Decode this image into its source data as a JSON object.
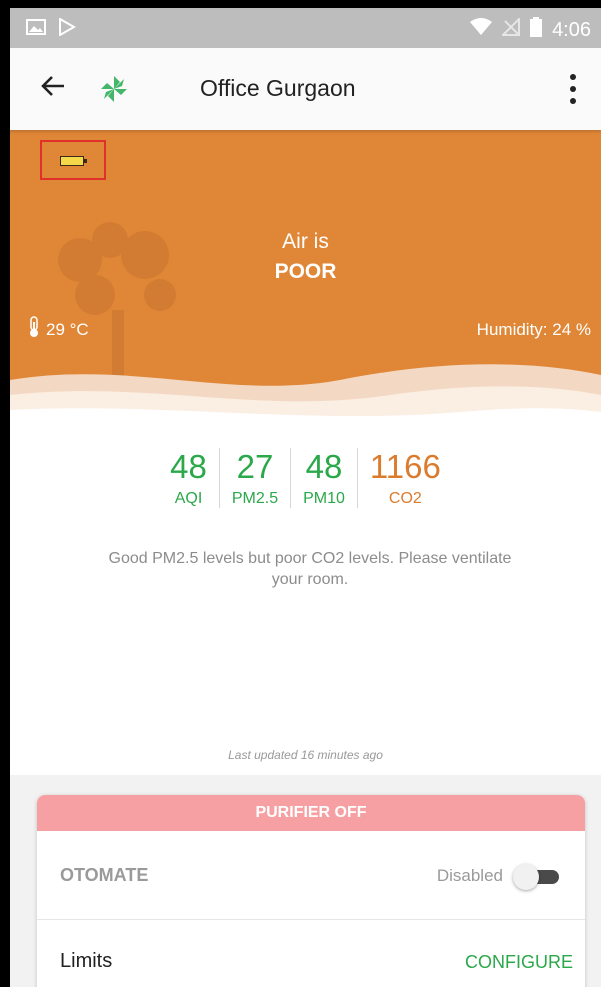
{
  "status_bar": {
    "time": "4:06"
  },
  "app_bar": {
    "title": "Office Gurgaon"
  },
  "hero": {
    "air_prefix": "Air is",
    "air_status": "POOR",
    "temperature": "29 °C",
    "humidity": "Humidity: 24 %"
  },
  "metrics": [
    {
      "value": "48",
      "label": "AQI",
      "color": "#2aa84a"
    },
    {
      "value": "27",
      "label": "PM2.5",
      "color": "#2aa84a"
    },
    {
      "value": "48",
      "label": "PM10",
      "color": "#2aa84a"
    },
    {
      "value": "1166",
      "label": "CO2",
      "color": "#db7b2e"
    }
  ],
  "message": "Good PM2.5 levels but poor CO2 levels. Please ventilate your room.",
  "last_updated": "Last updated 16 minutes ago",
  "purifier": {
    "header": "PURIFIER OFF",
    "otomate_label": "OTOMATE",
    "otomate_state": "Disabled",
    "limits_label": "Limits",
    "configure_label": "CONFIGURE"
  },
  "colors": {
    "hero_bg": "#e08737",
    "accent_green": "#2aa84a",
    "accent_orange": "#db7b2e",
    "card_header": "#f7a0a3"
  },
  "icons": [
    "image-icon",
    "play-store-icon",
    "wifi-icon",
    "no-sim-icon",
    "battery-status-icon",
    "back-arrow-icon",
    "pinwheel-logo-icon",
    "more-vert-icon",
    "battery-level-icon",
    "thermometer-icon",
    "tree-icon"
  ]
}
